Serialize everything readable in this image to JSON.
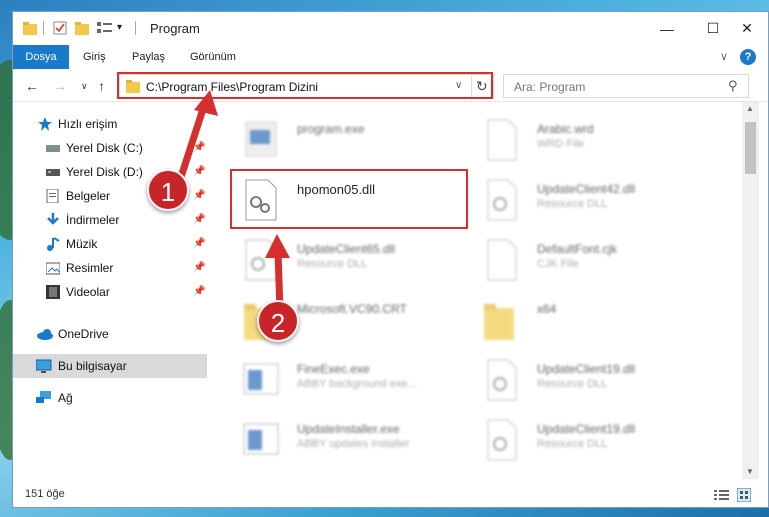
{
  "window": {
    "title": "Program",
    "minimize_glyph": "—",
    "maximize_glyph": "☐",
    "close_glyph": "✕"
  },
  "ribbon": {
    "tabs": [
      "Dosya",
      "Giriş",
      "Paylaş",
      "Görünüm"
    ],
    "expand_glyph": "∨",
    "help_glyph": "?"
  },
  "nav": {
    "back_glyph": "←",
    "forward_glyph": "→",
    "recent_glyph": "∨",
    "up_glyph": "↑",
    "address": "C:\\Program Files\\Program Dizini",
    "address_dropdown_glyph": "∨",
    "refresh_glyph": "↻",
    "search_placeholder": "Ara: Program",
    "search_glyph": "⚲"
  },
  "sidebar": {
    "items": [
      {
        "label": "Hızlı erişim",
        "icon": "star-icon",
        "pinned": false,
        "level": 0
      },
      {
        "label": "Yerel Disk (C:)",
        "icon": "drive-icon",
        "pinned": true,
        "level": 1
      },
      {
        "label": "Yerel Disk (D:)",
        "icon": "drive-icon",
        "pinned": true,
        "level": 1
      },
      {
        "label": "Belgeler",
        "icon": "documents-icon",
        "pinned": true,
        "level": 1
      },
      {
        "label": "İndirmeler",
        "icon": "download-icon",
        "pinned": true,
        "level": 1
      },
      {
        "label": "Müzik",
        "icon": "music-icon",
        "pinned": true,
        "level": 1
      },
      {
        "label": "Resimler",
        "icon": "pictures-icon",
        "pinned": true,
        "level": 1
      },
      {
        "label": "Videolar",
        "icon": "videos-icon",
        "pinned": true,
        "level": 1
      },
      {
        "label": "OneDrive",
        "icon": "cloud-icon",
        "pinned": false,
        "level": 0
      },
      {
        "label": "Bu bilgisayar",
        "icon": "computer-icon",
        "pinned": false,
        "level": 0,
        "selected": true
      },
      {
        "label": "Ağ",
        "icon": "network-icon",
        "pinned": false,
        "level": 0
      }
    ],
    "pin_glyph": "📌"
  },
  "files": {
    "left": [
      {
        "name": "program.exe",
        "sub": ""
      },
      {
        "name": "hpomon05.dll",
        "sub": ""
      },
      {
        "name": "UpdateClient65.dll",
        "sub": "Resource DLL"
      },
      {
        "name": "Microsoft.VC90.CRT",
        "sub": ""
      },
      {
        "name": "FineExec.exe",
        "sub": "ABBY background exe..."
      },
      {
        "name": "UpdateInstaller.exe",
        "sub": "ABBY updates installer"
      }
    ],
    "right": [
      {
        "name": "Arabic.wrd",
        "sub": "WRD File"
      },
      {
        "name": "UpdateClient42.dll",
        "sub": "Resource DLL"
      },
      {
        "name": "DefaultFont.cjk",
        "sub": "CJK File"
      },
      {
        "name": "x64",
        "sub": ""
      },
      {
        "name": "UpdateClient19.dll",
        "sub": "Resource DLL"
      },
      {
        "name": "UpdateClient19.dll",
        "sub": "Resource DLL"
      }
    ]
  },
  "status": {
    "count": "151 öğe"
  },
  "annotations": {
    "badge1": "1",
    "badge2": "2"
  },
  "colors": {
    "accent": "#1979ca",
    "annotation_red": "#d62f2f"
  }
}
